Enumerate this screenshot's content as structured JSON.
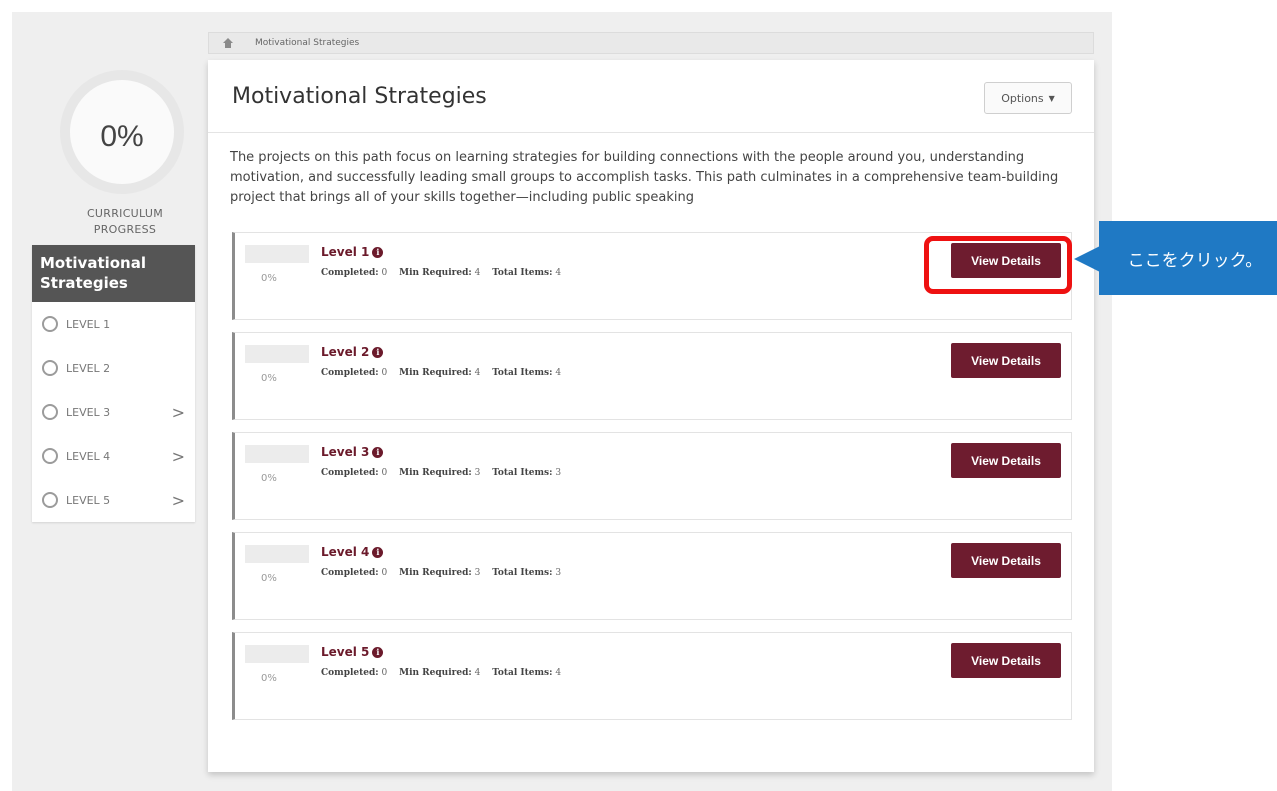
{
  "sidebar": {
    "progress": {
      "percent_text": "0%",
      "label_line1": "CURRICULUM",
      "label_line2": "PROGRESS"
    },
    "header_line1": "Motivational",
    "header_line2": "Strategies",
    "items": [
      {
        "label": "LEVEL 1",
        "chevron": ""
      },
      {
        "label": "LEVEL 2",
        "chevron": ""
      },
      {
        "label": "LEVEL 3",
        "chevron": ">"
      },
      {
        "label": "LEVEL 4",
        "chevron": ">"
      },
      {
        "label": "LEVEL 5",
        "chevron": ">"
      }
    ]
  },
  "breadcrumb": {
    "current": "Motivational Strategies"
  },
  "main": {
    "title": "Motivational Strategies",
    "options_label": "Options",
    "description": "The projects on this path focus on learning strategies for building connections with the people around you, understanding motivation, and successfully leading small groups to accomplish tasks. This path culminates in a comprehensive team-building project that brings all of your skills together—including public speaking",
    "stat_labels": {
      "completed": "Completed:",
      "min_required": "Min Required:",
      "total_items": "Total Items:"
    },
    "levels": [
      {
        "name": "Level 1",
        "percent": "0%",
        "completed": "0",
        "min_required": "4",
        "total_items": "4",
        "button": "View Details"
      },
      {
        "name": "Level 2",
        "percent": "0%",
        "completed": "0",
        "min_required": "4",
        "total_items": "4",
        "button": "View Details"
      },
      {
        "name": "Level 3",
        "percent": "0%",
        "completed": "0",
        "min_required": "3",
        "total_items": "3",
        "button": "View Details"
      },
      {
        "name": "Level 4",
        "percent": "0%",
        "completed": "0",
        "min_required": "3",
        "total_items": "3",
        "button": "View Details"
      },
      {
        "name": "Level 5",
        "percent": "0%",
        "completed": "0",
        "min_required": "4",
        "total_items": "4",
        "button": "View Details"
      }
    ]
  },
  "annotation": {
    "callout_text": "ここをクリック。"
  },
  "icons": {
    "home": "home-icon",
    "info": "info-circle-icon",
    "caret": "caret-down-icon",
    "level_status": "circle-outline-icon",
    "chevron": "chevron-right-icon"
  },
  "colors": {
    "accent": "#6e1c2f",
    "sidebar_header": "#555555",
    "callout": "#1f79c4",
    "highlight": "#ee1111"
  }
}
